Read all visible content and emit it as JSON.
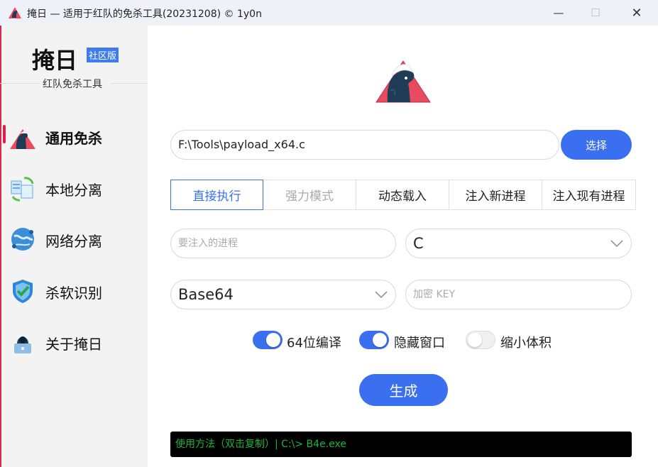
{
  "window": {
    "title": "掩日 — 适用于红队的免杀工具(20231208) © 1y0n",
    "minimize_glyph": "—",
    "maximize_glyph": "☐",
    "close_glyph": "✕"
  },
  "brand": {
    "title": "掩日",
    "badge": "社区版",
    "subtitle": "红队免杀工具"
  },
  "sidebar": {
    "items": [
      {
        "label": "通用免杀",
        "icon": "horse-icon",
        "active": true
      },
      {
        "label": "本地分离",
        "icon": "sync-files-icon",
        "active": false
      },
      {
        "label": "网络分离",
        "icon": "globe-icon",
        "active": false
      },
      {
        "label": "杀软识别",
        "icon": "shield-check-icon",
        "active": false
      },
      {
        "label": "关于掩日",
        "icon": "hacker-laptop-icon",
        "active": false
      }
    ]
  },
  "main": {
    "file_path": "F:\\Tools\\payload_x64.c",
    "select_button": "选择",
    "tabs": [
      {
        "label": "直接执行",
        "state": "active"
      },
      {
        "label": "强力模式",
        "state": "disabled"
      },
      {
        "label": "动态载入",
        "state": "normal"
      },
      {
        "label": "注入新进程",
        "state": "normal"
      },
      {
        "label": "注入现有进程",
        "state": "normal"
      }
    ],
    "process_placeholder": "要注入的进程",
    "language_select": "C",
    "encoding_select": "Base64",
    "key_placeholder": "加密 KEY",
    "toggles": [
      {
        "label": "64位编译",
        "on": true
      },
      {
        "label": "隐藏窗口",
        "on": true
      },
      {
        "label": "缩小体积",
        "on": false
      }
    ],
    "generate_button": "生成",
    "console_text": "使用方法（双击复制）|  C:\\> B4e.exe"
  },
  "colors": {
    "accent": "#3a6ff0",
    "badge": "#3d7bef",
    "console_text": "#1db33a",
    "brand_red": "#e11d48"
  }
}
